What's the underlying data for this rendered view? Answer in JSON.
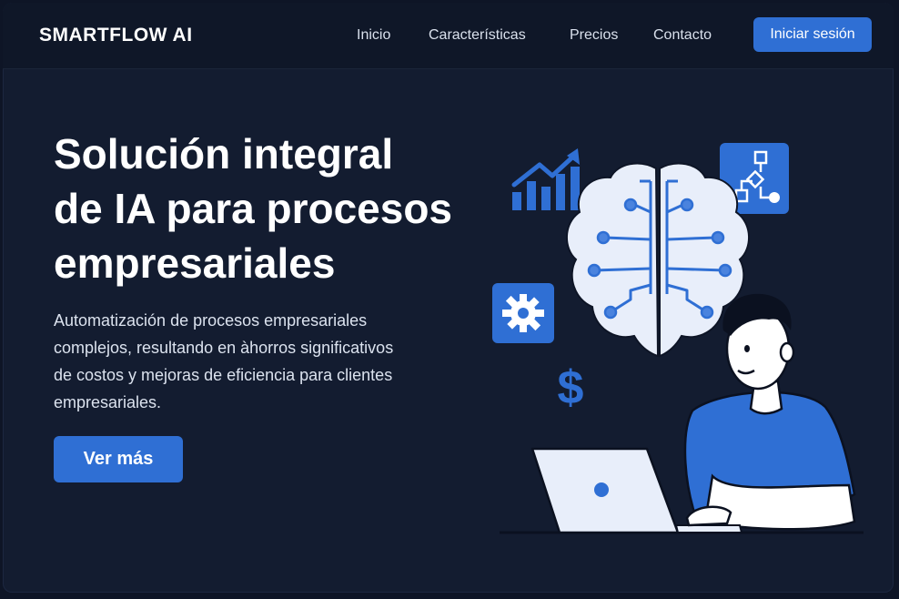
{
  "nav": {
    "brand": "SMARTFLOW AI",
    "links": [
      "Inicio",
      "Características",
      "Precios",
      "Contacto"
    ],
    "login_label": "Iniciar sesión"
  },
  "hero": {
    "title_lines": [
      "Solución integral",
      "de IA para procesos",
      "empresariales"
    ],
    "description_lines": [
      "Automatización de procesos empresariales",
      "complejos, resultando en àhorros significativos",
      "de costos y mejoras de eficiencia para clientes",
      "empresariales."
    ],
    "cta_label": "Ver más"
  },
  "illustration": {
    "icons": [
      "growth-chart-icon",
      "brain-circuit-icon",
      "flowchart-icon",
      "gear-icon",
      "dollar-icon",
      "person-with-laptop"
    ],
    "colors": {
      "accent": "#2f6fd4",
      "brain": "#e8eefa",
      "circuit": "#2f6fd4",
      "background": "#131c30"
    }
  }
}
